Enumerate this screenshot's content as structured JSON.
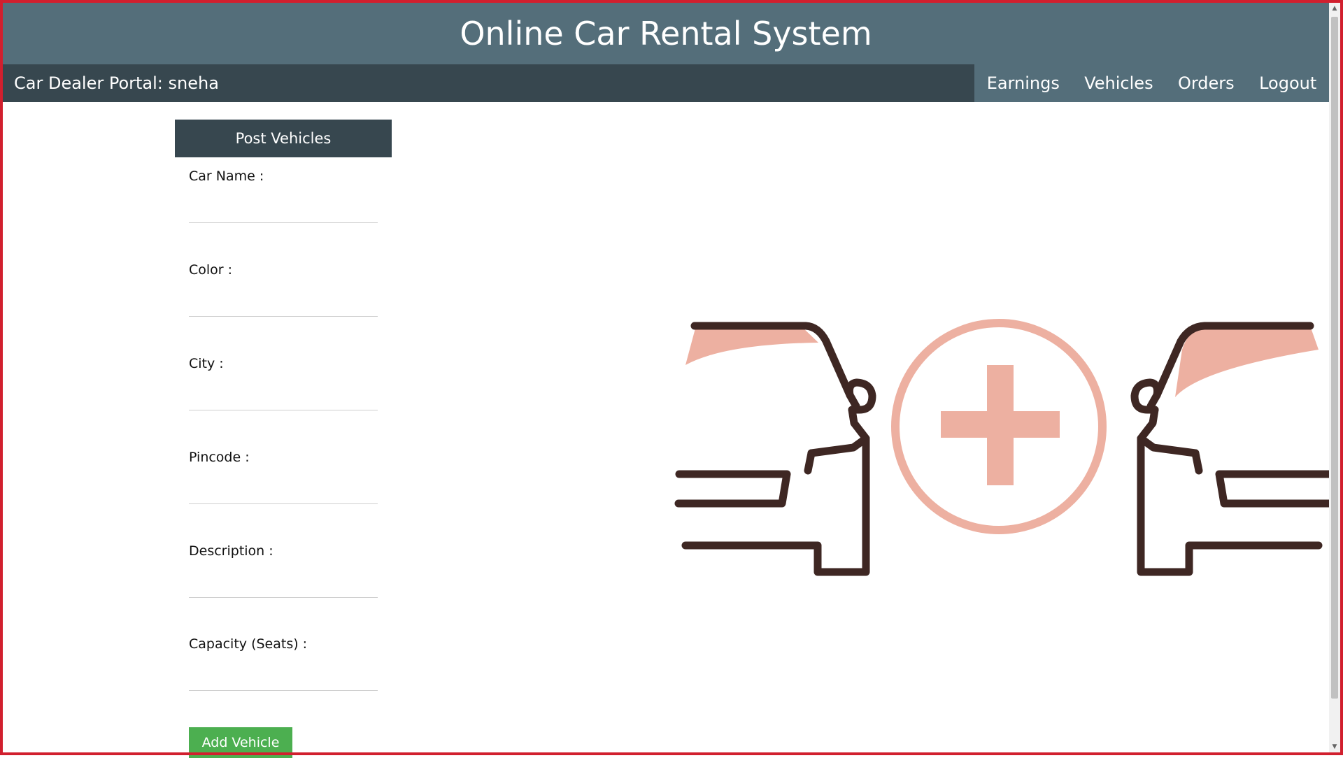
{
  "app": {
    "title": "Online Car Rental System"
  },
  "navbar": {
    "portal_label": "Car Dealer Portal: sneha",
    "links": [
      "Earnings",
      "Vehicles",
      "Orders",
      "Logout"
    ]
  },
  "form": {
    "title": "Post Vehicles",
    "fields": [
      {
        "label": "Car Name :",
        "value": ""
      },
      {
        "label": "Color :",
        "value": ""
      },
      {
        "label": "City :",
        "value": ""
      },
      {
        "label": "Pincode :",
        "value": ""
      },
      {
        "label": "Description :",
        "value": ""
      },
      {
        "label": "Capacity (Seats) :",
        "value": ""
      }
    ],
    "submit_label": "Add Vehicle"
  },
  "illustration": {
    "icon": "add-car-icon",
    "colors": {
      "outline": "#3e2723",
      "accent": "#edb0a1"
    }
  },
  "theme": {
    "header_bg": "#546e7a",
    "navbar_bg": "#37474f",
    "button_bg": "#4caf50",
    "frame_border": "#d11f2e"
  }
}
